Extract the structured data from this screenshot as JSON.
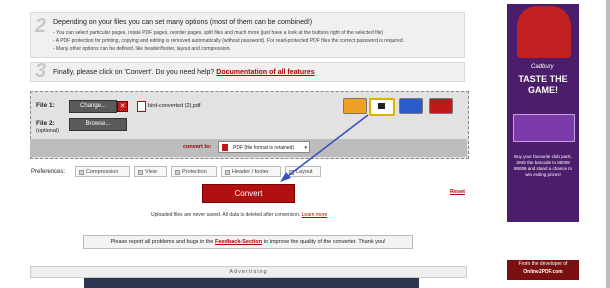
{
  "step2": {
    "number": "2",
    "title": "Depending on your files you can set many options (most of them can be combined!)",
    "bullets": [
      "- You can select particular pages, rotate PDF pages, reorder pages, split files and much more (just have a look at the buttons right of the selected file)",
      "- A PDF protection for printing, copying and editing is removed automatically (without password). For read-protected PDF files the correct password is required.",
      "- Many other options can be defined, like header/footer, layout and compression."
    ]
  },
  "step3": {
    "number": "3",
    "title": "Finally, please click on 'Convert'. Do you need help?",
    "link": "Documentation of all features"
  },
  "upload": {
    "file1_label": "File 1:",
    "file2_label": "File 2:",
    "file2_sub": "(optional)",
    "change_label": "Change...",
    "browse_label": "Browse...",
    "file_name": "bird-converted (2).pdf",
    "convert_to_label": "convert to:",
    "convert_to_value": "PDF (file format is retained)"
  },
  "tools": [
    "wrench-icon",
    "lock-icon",
    "rotate-icon",
    "scissors-icon"
  ],
  "preferences": {
    "label": "Preferences:",
    "items": [
      "Compression",
      "View",
      "Protection",
      "Header / footer",
      "Layout"
    ]
  },
  "actions": {
    "convert": "Convert",
    "reset": "Reset"
  },
  "notice": {
    "text": "Uploaded files are never saved. All data is deleted after conversion.",
    "link": "Learn more"
  },
  "report": {
    "pre": "Please report all problems and bugs in the",
    "link": "Feedback-Section",
    "post": "to improve the quality of the converter. Thank you!"
  },
  "advertising": "Advertising",
  "ad": {
    "brand": "Cadbury",
    "headline": "TASTE THE GAME!",
    "body": "Buy your favourite club pack, SMS the barcode to 85008 85008 and stand a chance to win exiting prizes!"
  },
  "developer": {
    "line1": "From the developer of",
    "line2": "Online2PDF.com"
  },
  "colors": {
    "accent_red": "#b01010",
    "arrow_blue": "#3a4fc4",
    "ad_purple": "#4b1d6b"
  }
}
